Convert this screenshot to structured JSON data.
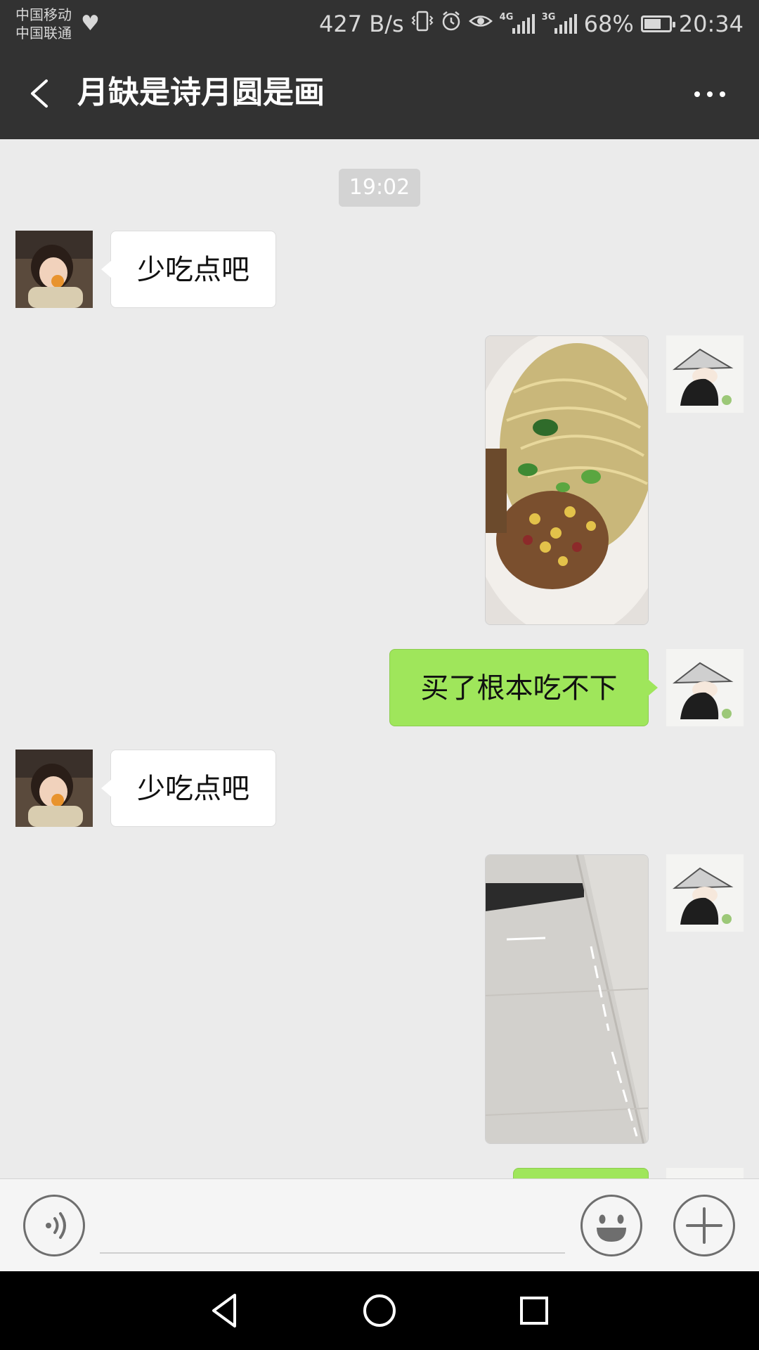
{
  "status_bar": {
    "carrier_1": "中国移动",
    "carrier_2": "中国联通",
    "net_speed": "427 B/s",
    "signal_tag_1": "4G",
    "signal_tag_2": "3G",
    "battery_text": "68%",
    "battery_level": 0.68,
    "time": "20:34",
    "icons": [
      "heart-health-icon",
      "vibrate-icon",
      "alarm-icon",
      "eye-icon",
      "signal-4g-icon",
      "signal-3g-icon",
      "battery-icon"
    ]
  },
  "header": {
    "title": "月缺是诗月圆是画",
    "back_icon": "chevron-left-icon",
    "more_icon": "more-dots-icon"
  },
  "chat": {
    "timestamp": "19:02",
    "messages": [
      {
        "side": "incoming",
        "type": "text",
        "text": "少吃点吧"
      },
      {
        "side": "outgoing",
        "type": "image",
        "content": "noodles-photo"
      },
      {
        "side": "outgoing",
        "type": "text",
        "text": "买了根本吃不下"
      },
      {
        "side": "incoming",
        "type": "text",
        "text": "少吃点吧"
      },
      {
        "side": "outgoing",
        "type": "image",
        "content": "floor-photo"
      },
      {
        "side": "outgoing",
        "type": "text",
        "text": ""
      }
    ]
  },
  "input_bar": {
    "voice_icon": "voice-icon",
    "input_value": "",
    "emoji_icon": "emoji-icon",
    "plus_icon": "plus-icon"
  },
  "nav_bar": {
    "icons": [
      "back-triangle-icon",
      "home-circle-icon",
      "recents-square-icon"
    ]
  },
  "colors": {
    "header_bg": "#323232",
    "chat_bg": "#ebebeb",
    "incoming_bubble": "#ffffff",
    "outgoing_bubble": "#9fe65b",
    "timestamp_chip": "#d3d3d3",
    "nav_bg": "#000000"
  }
}
